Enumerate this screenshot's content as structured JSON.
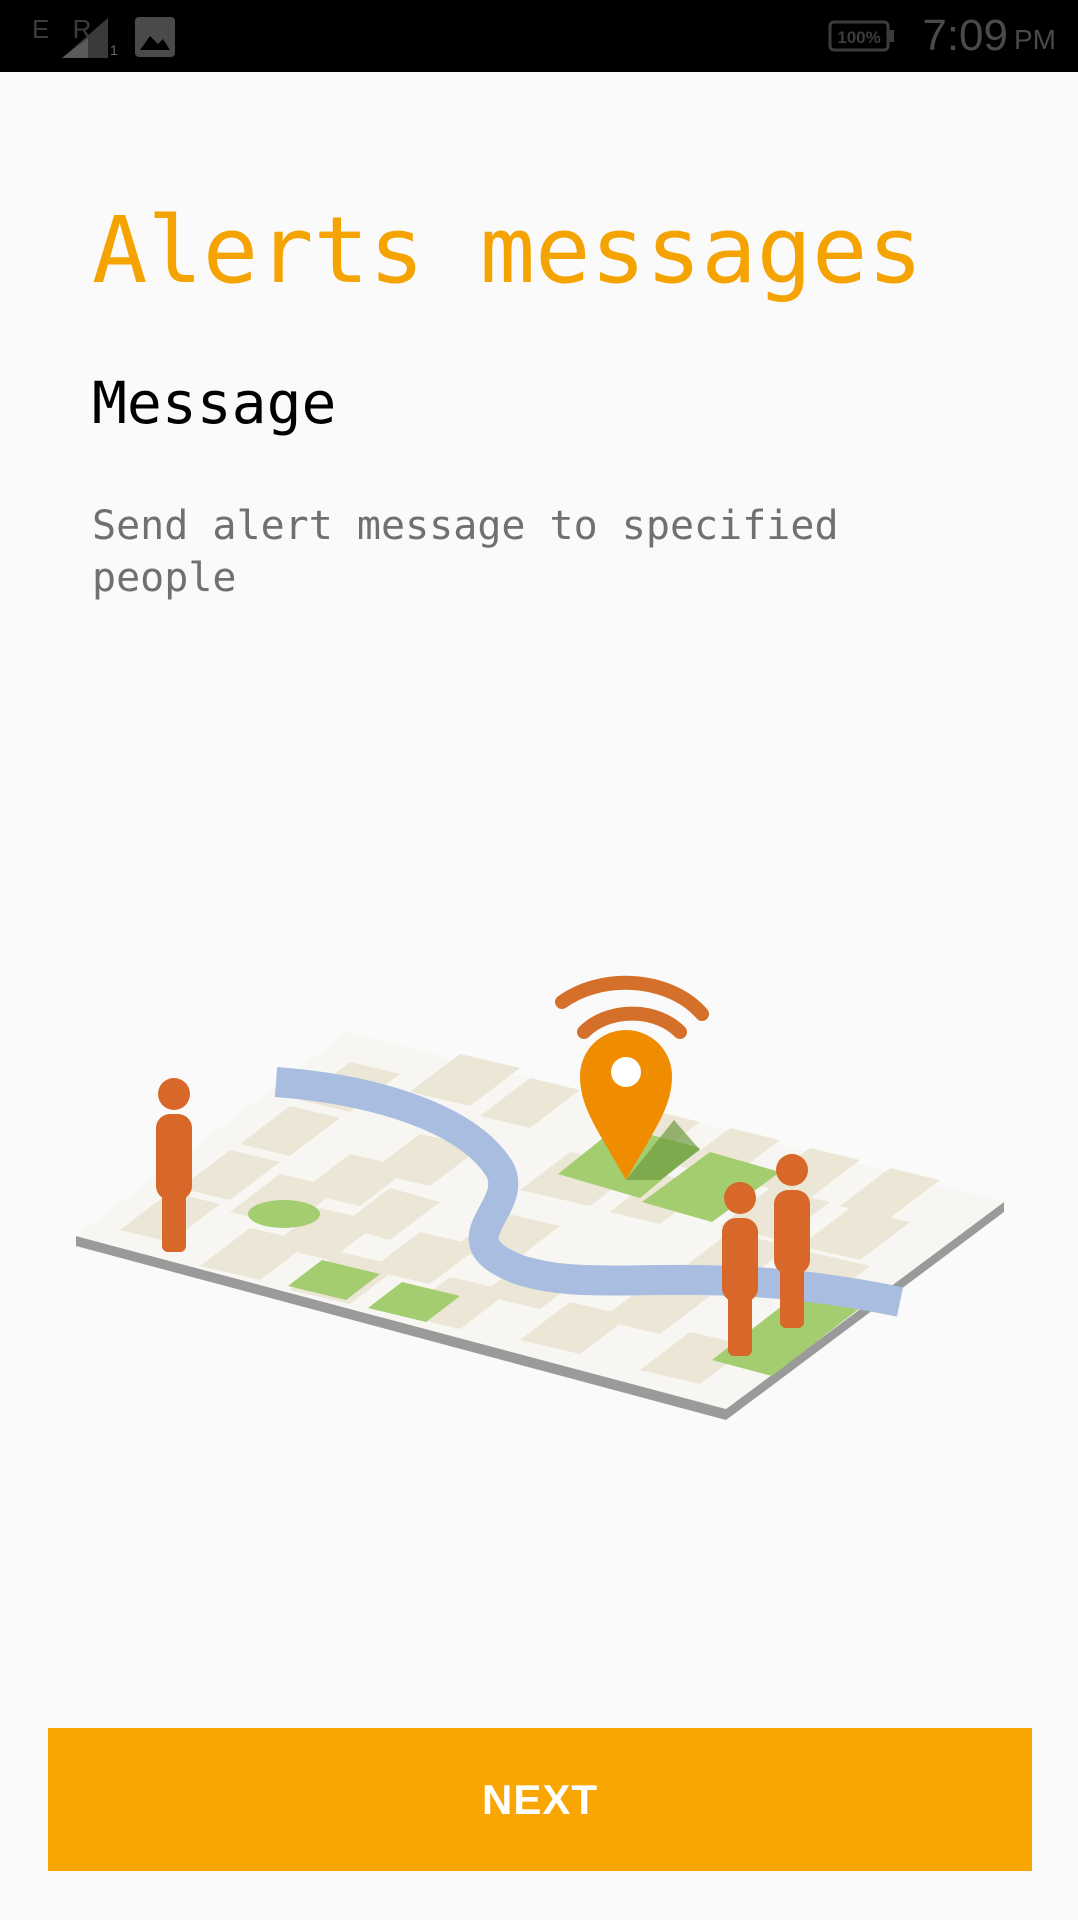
{
  "status_bar": {
    "carrier": "E R",
    "sim_slot": "1",
    "battery": "100%",
    "time": "7:09",
    "ampm": "PM",
    "icons": [
      "signal-icon",
      "gallery-icon",
      "battery-icon"
    ]
  },
  "main": {
    "title": "Alerts messages",
    "subtitle": "Message",
    "description": "Send alert message to specified people",
    "illustration": "city-map-with-location-pin-and-people"
  },
  "footer": {
    "next_label": "NEXT"
  },
  "colors": {
    "accent": "#f5a300",
    "button": "#f9a602",
    "pin": "#f08c00",
    "person": "#d8672a",
    "status_bar": "#000000",
    "background": "#fafafa"
  }
}
